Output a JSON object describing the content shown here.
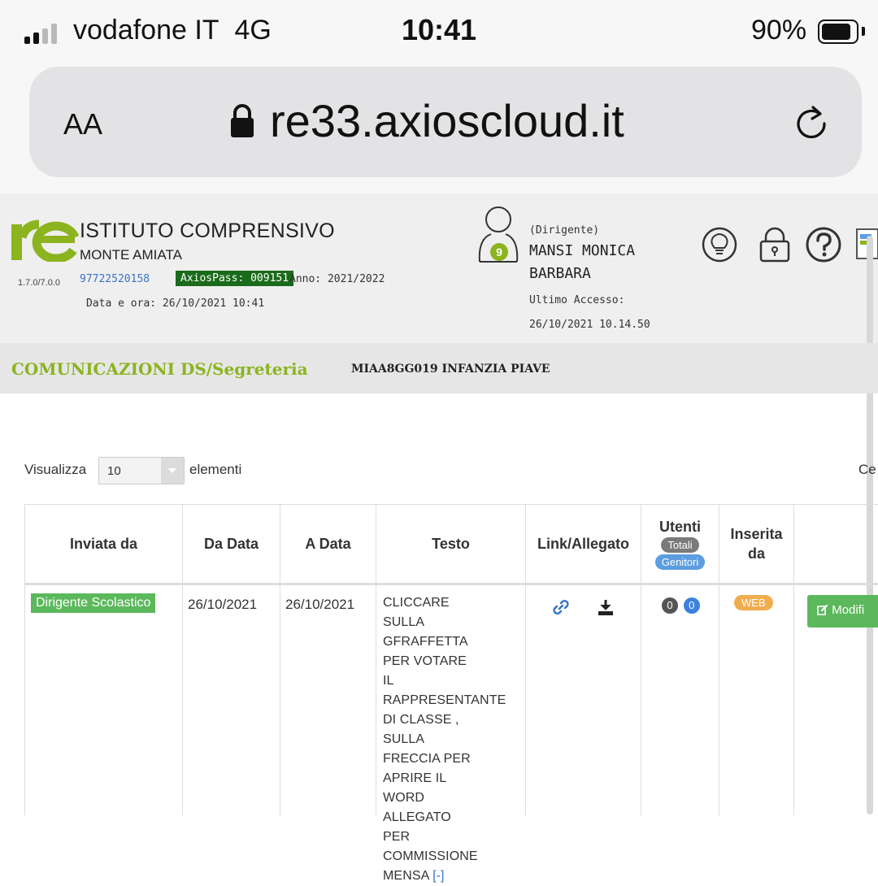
{
  "status_bar": {
    "carrier": "vodafone IT",
    "network": "4G",
    "time": "10:41",
    "battery": "90%"
  },
  "browser": {
    "text_size_label": "AA",
    "url": "re33.axioscloud.it"
  },
  "header": {
    "version": "1.7.0/7.0.0",
    "school_name": "ISTITUTO COMPRENSIVO",
    "school_subname": "MONTE AMIATA",
    "school_code": "97722520158",
    "axios_pass": "AxiosPass: 009151",
    "anno": "Anno: 2021/2022",
    "datetime": "Data e ora: 26/10/2021 10:41",
    "user_badge_count": "9",
    "user_role": "(Dirigente)",
    "user_name_line1": "MANSI MONICA",
    "user_name_line2": "BARBARA",
    "last_access_label": "Ultimo Accesso:",
    "last_access_value": "26/10/2021 10.14.50"
  },
  "section": {
    "title": "COMUNICAZIONI DS/Segreteria",
    "school": "MIAA8GG019 INFANZIA PIAVE"
  },
  "length_selector": {
    "prefix": "Visualizza",
    "value": "10",
    "suffix": "elementi",
    "search_label": "Ce"
  },
  "table": {
    "headers": {
      "inviata_da": "Inviata da",
      "da_data": "Da Data",
      "a_data": "A Data",
      "testo": "Testo",
      "link_allegato": "Link/Allegato",
      "utenti": "Utenti",
      "totali": "Totali",
      "genitori": "Genitori",
      "inserita_da": "Inserita da"
    },
    "rows": [
      {
        "inviata_da": "Dirigente Scolastico",
        "da_data": "26/10/2021",
        "a_data": "26/10/2021",
        "testo": "CLICCARE SULLA GFRAFFETTA PER VOTARE IL RAPPRESENTANTE DI CLASSE , SULLA FRECCIA PER APRIRE IL WORD ALLEGATO PER COMMISSIONE MENSA",
        "toggle": "[-]",
        "totali": "0",
        "genitori": "0",
        "inserita_da": "WEB",
        "action": "Modifi"
      }
    ]
  },
  "colors": {
    "accent_green": "#8bb41e",
    "badge_green": "#5cb85c",
    "axios_pass_bg": "#1a6b1a",
    "link_blue": "#3a74c6",
    "web_orange": "#f0ad4e"
  },
  "icons": [
    "signal-icon",
    "battery-icon",
    "lock-icon",
    "reload-icon",
    "logo-icon",
    "user-avatar-icon",
    "lightbulb-icon",
    "padlock-icon",
    "help-icon",
    "document-icon",
    "link-icon",
    "download-icon",
    "edit-icon",
    "dropdown-arrow-icon"
  ]
}
